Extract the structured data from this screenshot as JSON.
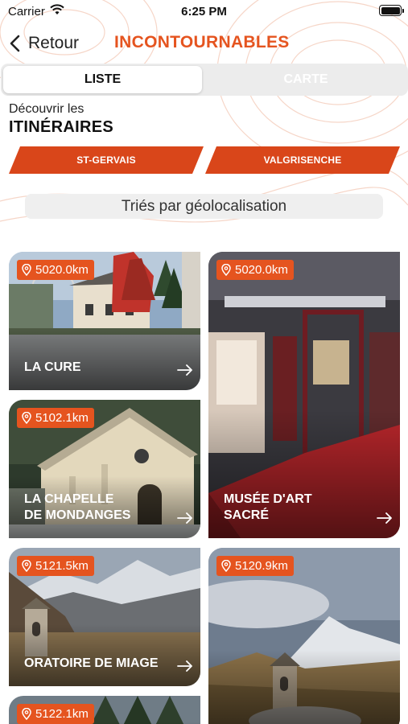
{
  "status_bar": {
    "carrier": "Carrier",
    "time": "6:25 PM"
  },
  "nav": {
    "back_label": "Retour",
    "title": "INCONTOURNABLES"
  },
  "segments": {
    "list_label": "LISTE",
    "map_label": "CARTE",
    "selected": "LISTE"
  },
  "intro": {
    "discover": "Découvrir les",
    "heading": "ITINÉRAIRES"
  },
  "regions": [
    {
      "label": "ST-GERVAIS"
    },
    {
      "label": "VALGRISENCHE"
    }
  ],
  "sort": {
    "label": "Triés par géolocalisation"
  },
  "cards": [
    {
      "distance": "5020.0km",
      "title": "LA CURE"
    },
    {
      "distance": "5020.0km",
      "title": "MUSÉE D'ART\nSACRÉ"
    },
    {
      "distance": "5102.1km",
      "title": "LA CHAPELLE\nDE MONDANGES"
    },
    {
      "distance": "5121.5km",
      "title": "ORATOIRE DE MIAGE"
    },
    {
      "distance": "5120.9km",
      "title": ""
    },
    {
      "distance": "5122.1km",
      "title": ""
    }
  ],
  "colors": {
    "accent": "#e5541f",
    "button": "#d9461a"
  }
}
